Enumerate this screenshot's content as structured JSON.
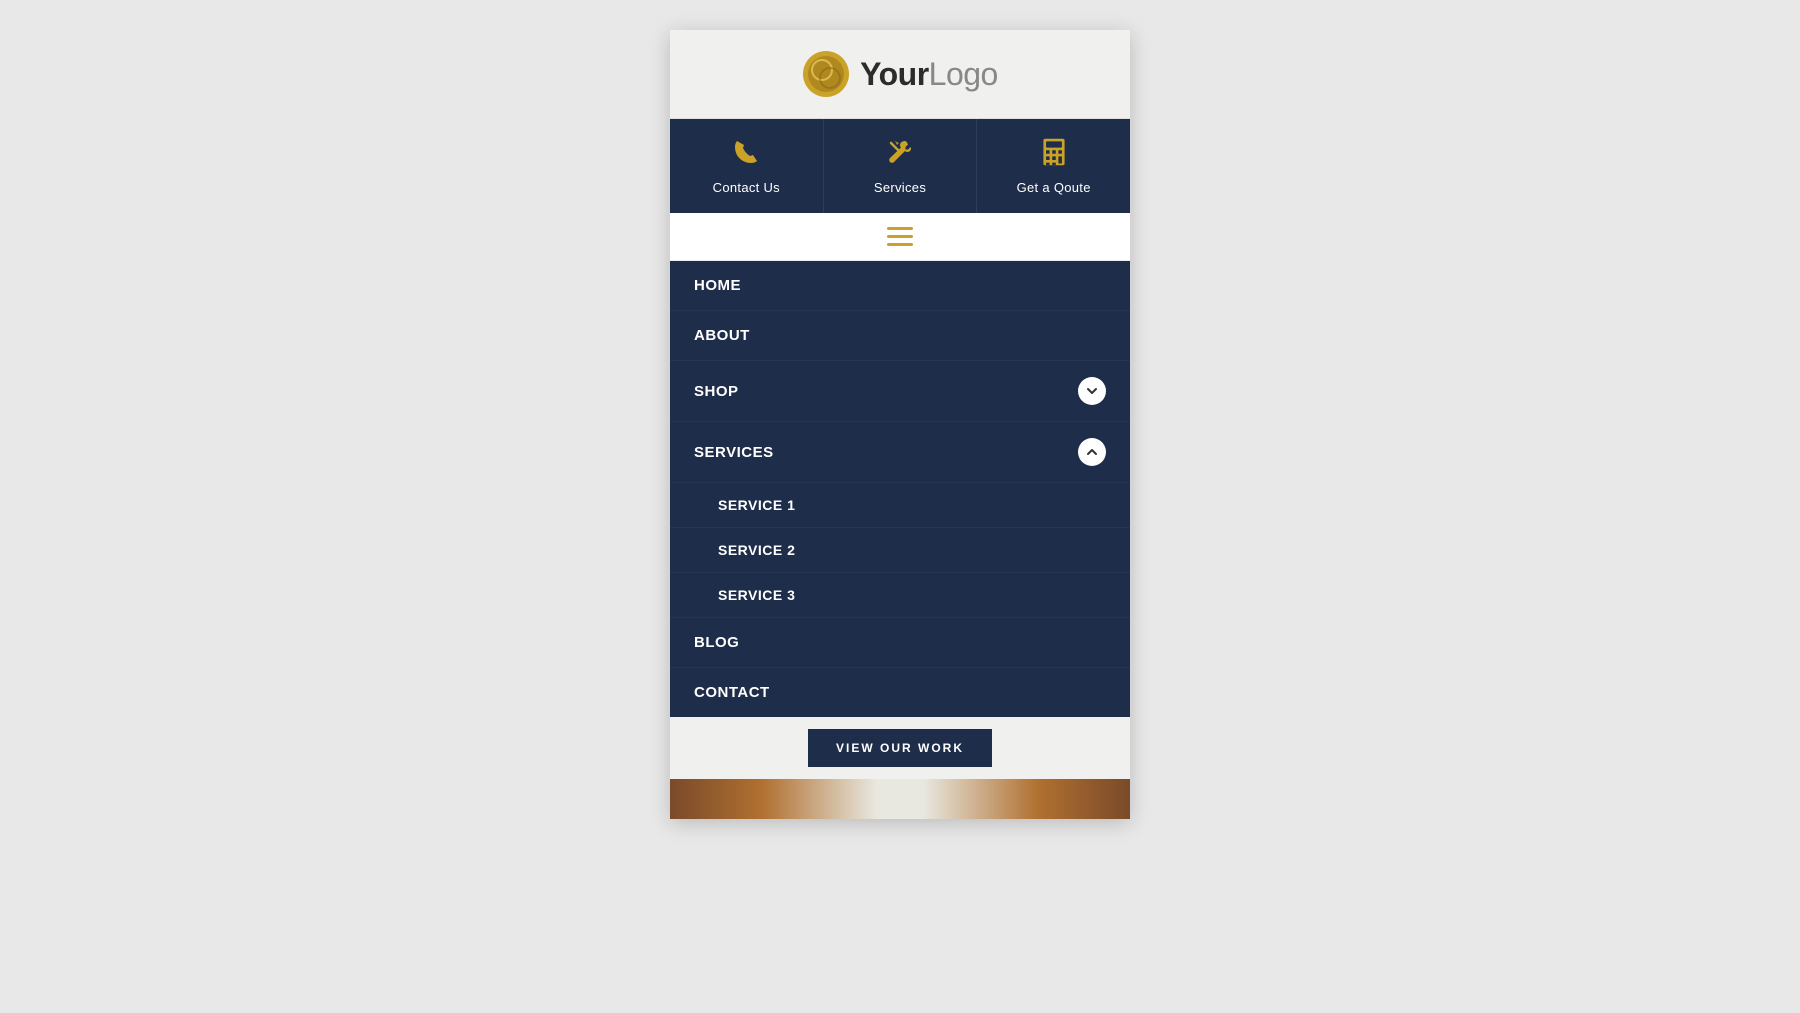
{
  "header": {
    "logo_bold": "Your",
    "logo_light": "Logo"
  },
  "top_nav": {
    "items": [
      {
        "id": "contact",
        "label": "Contact Us",
        "icon": "phone"
      },
      {
        "id": "services",
        "label": "Services",
        "icon": "wrench"
      },
      {
        "id": "quote",
        "label": "Get a Qoute",
        "icon": "calculator"
      }
    ]
  },
  "nav_menu": {
    "items": [
      {
        "id": "home",
        "label": "HOME",
        "has_chevron": false,
        "expanded": false
      },
      {
        "id": "about",
        "label": "ABOUT",
        "has_chevron": false,
        "expanded": false
      },
      {
        "id": "shop",
        "label": "SHOP",
        "has_chevron": true,
        "chevron_dir": "down",
        "expanded": false
      },
      {
        "id": "services",
        "label": "SERVICES",
        "has_chevron": true,
        "chevron_dir": "up",
        "expanded": true
      },
      {
        "id": "blog",
        "label": "BLOG",
        "has_chevron": false,
        "expanded": false
      },
      {
        "id": "contact",
        "label": "CONTACT",
        "has_chevron": false,
        "expanded": false
      }
    ],
    "sub_items": [
      {
        "id": "service1",
        "label": "SERVICE 1",
        "parent": "services"
      },
      {
        "id": "service2",
        "label": "SERVICE 2",
        "parent": "services"
      },
      {
        "id": "service3",
        "label": "SERVICE 3",
        "parent": "services"
      }
    ]
  },
  "cta": {
    "view_work_label": "VIEW OUR WORK"
  },
  "colors": {
    "navy": "#1e2d4a",
    "gold": "#c9a227",
    "white": "#ffffff",
    "bg_light": "#f0f0ee"
  }
}
